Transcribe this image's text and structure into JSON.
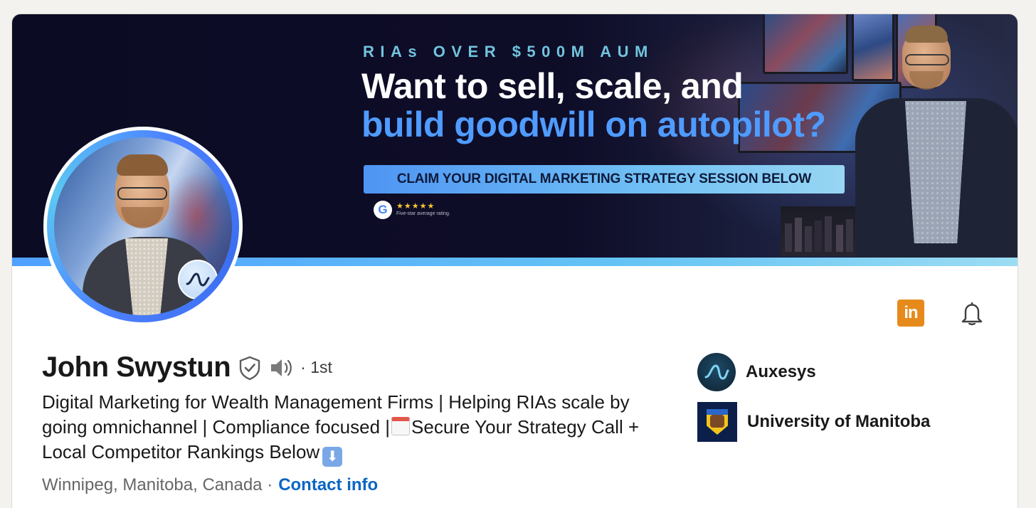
{
  "banner": {
    "kicker": "RIAs OVER $500M AUM",
    "headline_line1": "Want to sell, scale, and",
    "headline_line2": "build goodwill on autopilot?",
    "cta": "CLAIM YOUR DIGITAL MARKETING STRATEGY SESSION BELOW",
    "rating_stars": "★★★★★",
    "rating_caption": "Five-star average rating.",
    "google_letter": "G"
  },
  "actions": {
    "linkedin_icon_text": "in"
  },
  "profile": {
    "name": "John Swystun",
    "connection_degree": "· 1st",
    "headline_part1": "Digital Marketing for Wealth Management Firms | Helping RIAs scale by going omnichannel | Compliance focused |",
    "headline_part2": "Secure Your Strategy Call + Local Competitor Rankings Below",
    "down_arrow": "⬇",
    "location": "Winnipeg, Manitoba, Canada ·",
    "contact_link": "Contact info"
  },
  "affiliations": [
    {
      "label": "Auxesys"
    },
    {
      "label": "University of Manitoba"
    }
  ],
  "colors": {
    "link_blue": "#0a66c2",
    "banner_bg": "#0c0b24",
    "accent_blue": "#4f9bff",
    "linkedin_orange": "#e68a1b"
  },
  "icons": [
    "verified-shield-icon",
    "speaker-icon",
    "linkedin-icon",
    "bell-icon",
    "google-icon",
    "calendar-emoji-icon",
    "down-arrow-emoji-icon"
  ]
}
